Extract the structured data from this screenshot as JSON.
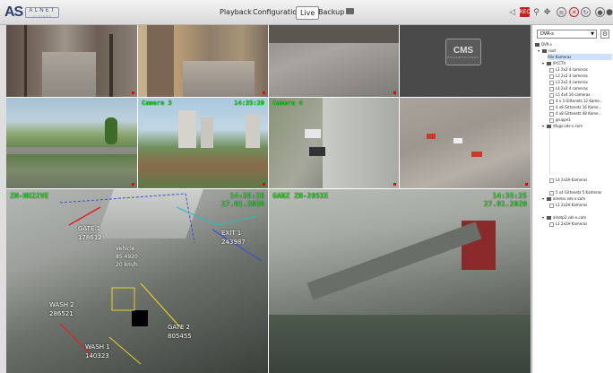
{
  "app": {
    "logo_main": "AS",
    "logo_name": "ALNET",
    "logo_sub": "SYSTEMS"
  },
  "menu": {
    "playback": "Playback",
    "configuration": "Configuration",
    "live": "Live",
    "backup": "Backup"
  },
  "toolbar": {
    "volume_icon": "speaker-icon",
    "record_icon": "REC",
    "zoom_icon": "magnifier-icon",
    "ptz_icon": "ptz-icon",
    "btn1": "≡",
    "btn2": "✕",
    "btn3": "↻",
    "btn4": "●"
  },
  "cameras": {
    "cam7_label": "Camera 3",
    "cam7_time": "14:35:20",
    "cam8_label": "Camera 4",
    "cam9_label": "ZN-NH22VE",
    "cam9_time": "14:35:26",
    "cam9_date": "27.01.2020",
    "cam10_label": "GANZ ZN-20SXE",
    "cam10_time": "14:35:25",
    "cam10_date": "27.01.2020",
    "cms_logo": "CMS",
    "cms_sub": "PROFESSIONAL",
    "gate1": "GATE 1",
    "gate1_id": "178612",
    "vehicle": "Vehicle",
    "vehicle_id": "85 4920",
    "vehicle_speed": "20 km/h",
    "exit1": "EXIT 1",
    "exit1_id": "243987",
    "wash2": "WASH 2",
    "wash2_id": "286521",
    "gate2": "GATE 2",
    "gate2_id": "805455",
    "wash1": "WASH 1",
    "wash1_id": "140323"
  },
  "sidebar": {
    "dvr_select": "DVR-s",
    "tree": [
      "DVR-s",
      "root",
      "Alle Kameras",
      "IPCCTV",
      "L1 2x2 4 cameras",
      "L2 2x2 4 cameras",
      "L3 2x2 4 cameras",
      "L4 2x2 4 cameras",
      "L5 4x4 16 cameras",
      "4 x 3 Gittenetz 12 Kame...",
      "4 x8 Gittenetz 16 Kame...",
      "4 x8 Gittenetz 48 Kame...",
      "gruppe1",
      "dfugs.vds-x.com",
      "L4 2x2H Kameras",
      "5 x4 Gittenetz 5 Kameras",
      "alnetss.vds-x.com",
      "L1 2x2H Kameras",
      "alnetp2.vds-x.com",
      "L1 2x2H Kameras"
    ]
  }
}
